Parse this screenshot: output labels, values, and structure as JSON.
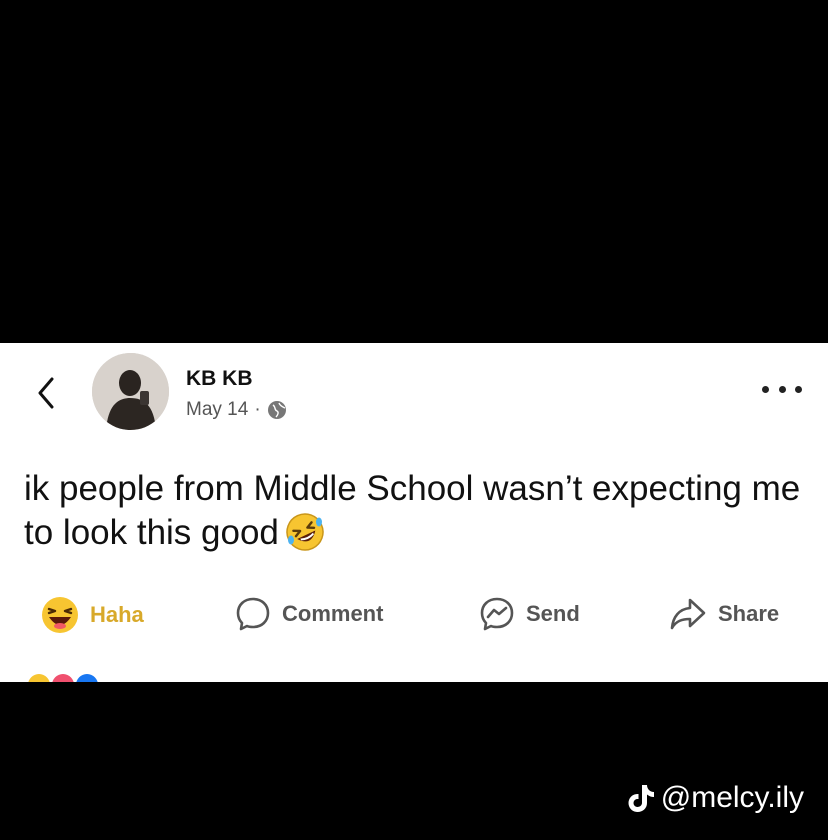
{
  "post": {
    "author": "KB KB",
    "date": "May 14",
    "separator": "·",
    "text": "ik people from Middle School wasn’t expecting me to look this good"
  },
  "actions": [
    {
      "label": "Haha",
      "icon": "haha-emoji-icon"
    },
    {
      "label": "Comment",
      "icon": "comment-icon"
    },
    {
      "label": "Send",
      "icon": "messenger-icon"
    },
    {
      "label": "Share",
      "icon": "share-arrow-icon"
    }
  ],
  "watermark": {
    "handle": "@melcy.ily",
    "icon": "tiktok-icon"
  },
  "colors": {
    "background": "#000000",
    "card": "#ffffff",
    "haha": "#d8a92a",
    "action_text": "#555555"
  }
}
